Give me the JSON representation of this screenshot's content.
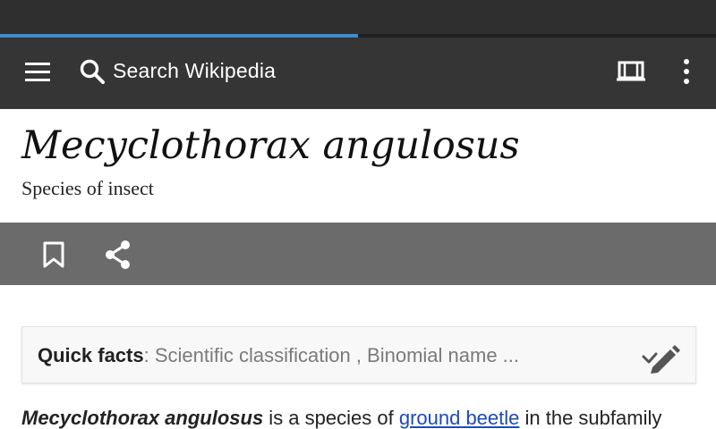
{
  "toolbar": {
    "search_placeholder": "Search Wikipedia",
    "load_progress": 0.5
  },
  "article": {
    "title": "Mecyclothorax angulosus",
    "description": "Species of insect"
  },
  "quick_facts": {
    "label": "Quick facts",
    "separator": ": ",
    "summary": "Scientific classification , Binomial name ..."
  },
  "body": {
    "intro_bold": "Mecyclothorax angulosus",
    "text_1": " is a species of ",
    "link_1": "ground beetle",
    "text_2": " in the subfamily"
  },
  "colors": {
    "app_bar": "#353535",
    "progress": "#3d8ccc",
    "action_bar": "#6b6b6b",
    "link": "#1e4ab8"
  },
  "icons": [
    "hamburger-menu-icon",
    "search-icon",
    "reading-list-icon",
    "overflow-menu-icon",
    "bookmark-icon",
    "share-icon",
    "expand-pencil-icon"
  ]
}
